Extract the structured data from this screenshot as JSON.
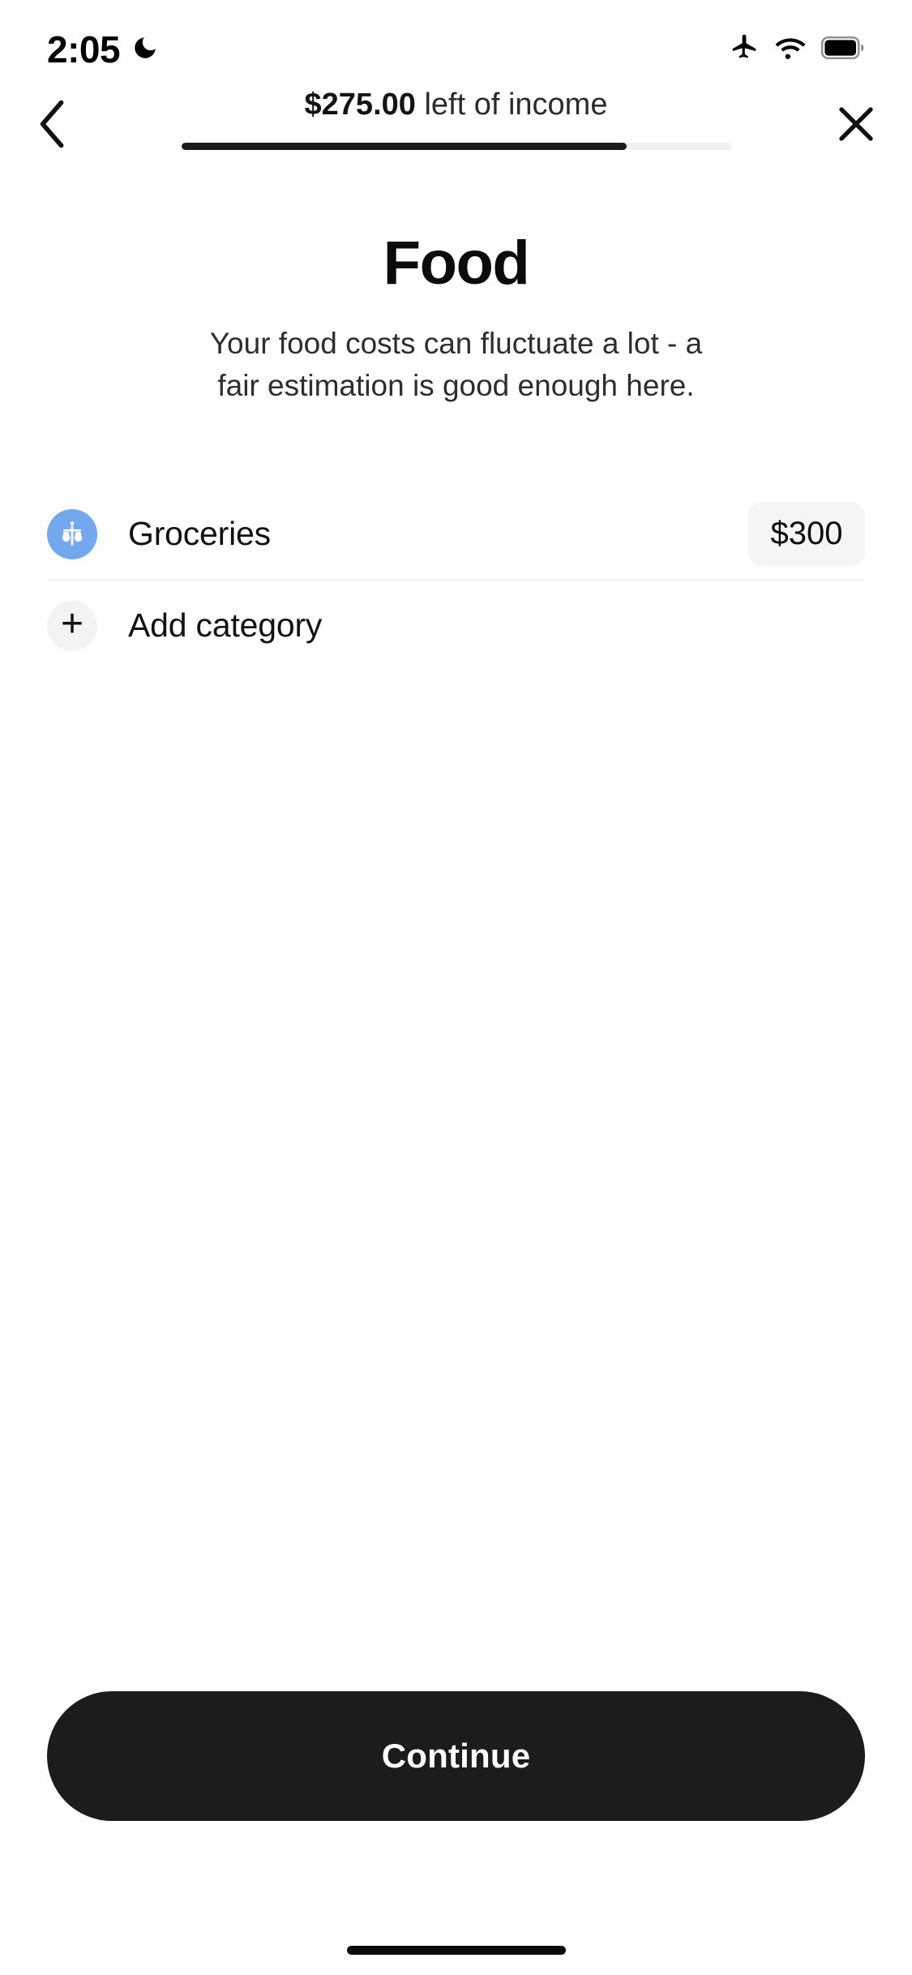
{
  "status_bar": {
    "time": "2:05",
    "icons": [
      "moon-icon",
      "airplane-mode-icon",
      "wifi-icon",
      "battery-icon"
    ]
  },
  "header": {
    "back_icon": "chevron-left-icon",
    "close_icon": "close-x-icon",
    "amount_left": "$275.00",
    "amount_suffix": " left of income",
    "progress_percent": 81,
    "progress_fill_color": "#1c1c1c",
    "progress_track_color": "#f0f0f2"
  },
  "main": {
    "title": "Food",
    "subtitle": "Your food costs can fluctuate a lot - a fair estimation is good enough here."
  },
  "categories": [
    {
      "icon": "groceries-shopper-icon",
      "icon_color": "#74a8ee",
      "label": "Groceries",
      "amount": "$300"
    }
  ],
  "add_category": {
    "icon": "plus-icon",
    "icon_color": "#f3f3f5",
    "label": "Add category"
  },
  "footer": {
    "continue_label": "Continue"
  }
}
